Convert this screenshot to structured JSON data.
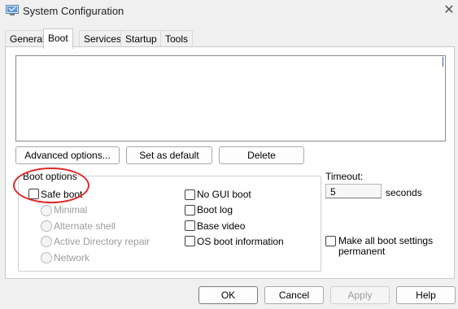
{
  "window": {
    "title": "System Configuration",
    "icon": "system-config-icon",
    "close_glyph": "✕"
  },
  "tabs": [
    {
      "label": "General",
      "active": false
    },
    {
      "label": "Boot",
      "active": true
    },
    {
      "label": "Services",
      "active": false
    },
    {
      "label": "Startup",
      "active": false
    },
    {
      "label": "Tools",
      "active": false
    }
  ],
  "boot_entries": [],
  "buttons": {
    "advanced": "Advanced options...",
    "set_default": "Set as default",
    "delete": "Delete"
  },
  "boot_options": {
    "legend": "Boot options",
    "safe_boot": {
      "label": "Safe boot",
      "checked": false
    },
    "minimal": {
      "label": "Minimal",
      "enabled": false
    },
    "alternate_shell": {
      "label": "Alternate shell",
      "enabled": false
    },
    "active_directory": {
      "label": "Active Directory repair",
      "enabled": false
    },
    "network": {
      "label": "Network",
      "enabled": false
    },
    "no_gui_boot": {
      "label": "No GUI boot",
      "checked": false
    },
    "boot_log": {
      "label": "Boot log",
      "checked": false
    },
    "base_video": {
      "label": "Base video",
      "checked": false
    },
    "os_boot_info": {
      "label": "OS boot information",
      "checked": false
    }
  },
  "timeout": {
    "label": "Timeout:",
    "value": "5",
    "unit": "seconds"
  },
  "make_permanent": {
    "label_line1": "Make all boot settings",
    "label_line2": "permanent",
    "checked": false
  },
  "footer": {
    "ok": "OK",
    "cancel": "Cancel",
    "apply": "Apply",
    "help": "Help"
  },
  "accent": {
    "highlight": "#e02828"
  }
}
